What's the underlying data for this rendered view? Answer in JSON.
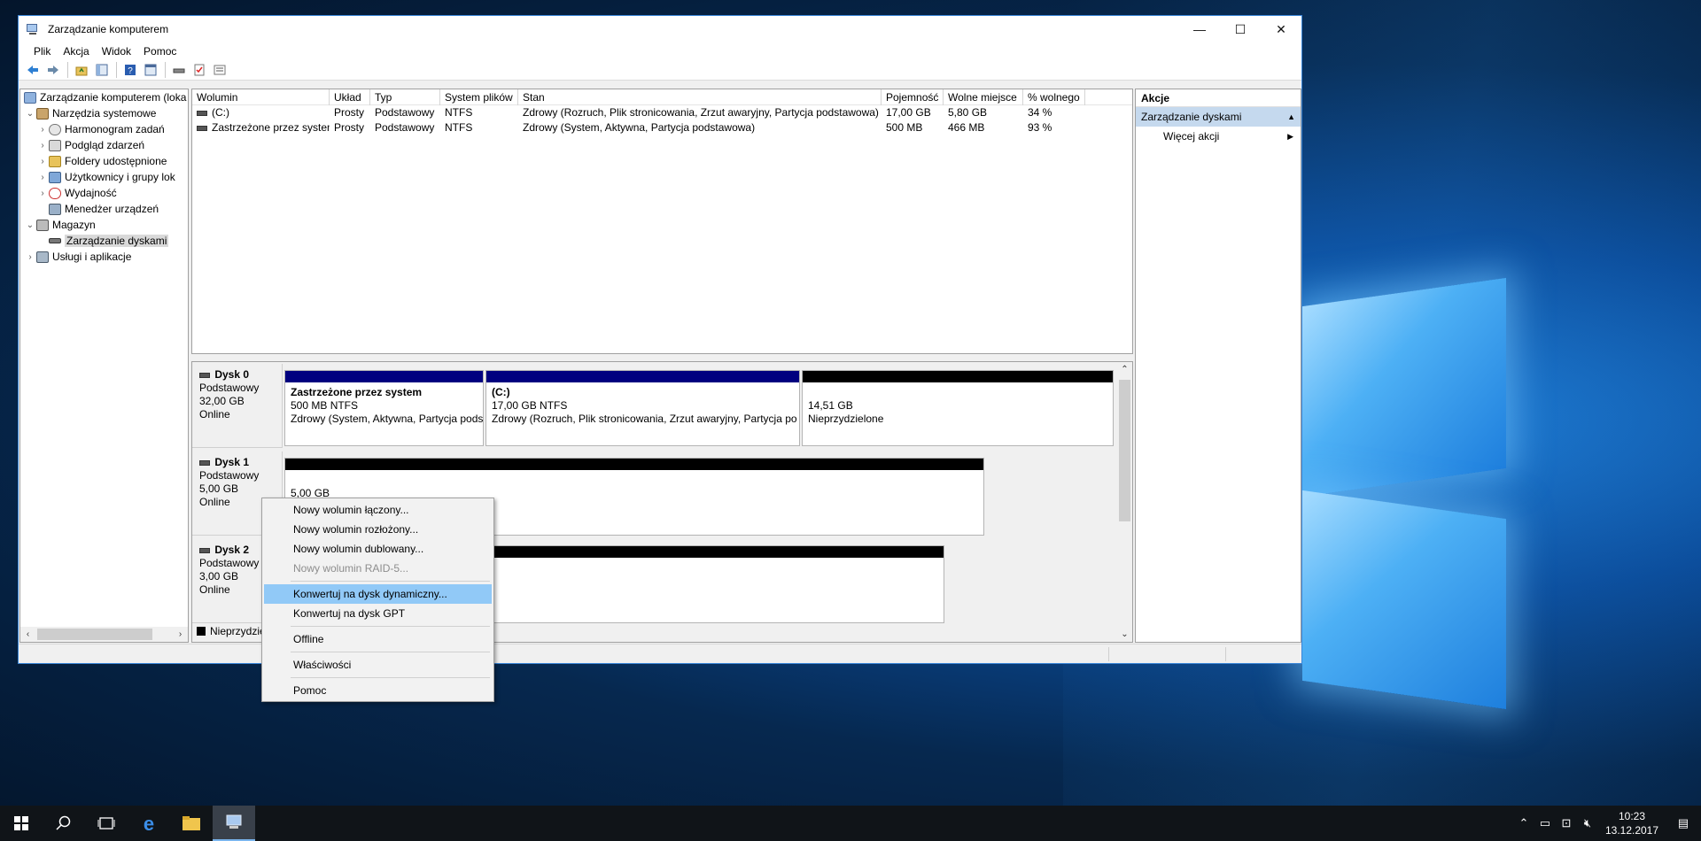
{
  "window": {
    "title": "Zarządzanie komputerem",
    "controls": {
      "minimize": "—",
      "maximize": "☐",
      "close": "✕"
    }
  },
  "menu": [
    "Plik",
    "Akcja",
    "Widok",
    "Pomoc"
  ],
  "toolbar_icons": [
    "back-icon",
    "forward-icon",
    "up-folder-icon",
    "show-tree-icon",
    "help-icon",
    "show-pane-icon",
    "disk-icon",
    "check-icon",
    "properties-icon"
  ],
  "tree": {
    "root": "Zarządzanie komputerem (loka",
    "system_tools": "Narzędzia systemowe",
    "task_scheduler": "Harmonogram zadań",
    "event_viewer": "Podgląd zdarzeń",
    "shared_folders": "Foldery udostępnione",
    "users_groups": "Użytkownicy i grupy lok",
    "performance": "Wydajność",
    "device_manager": "Menedżer urządzeń",
    "storage": "Magazyn",
    "disk_management": "Zarządzanie dyskami",
    "services_apps": "Usługi i aplikacje"
  },
  "volumes": {
    "headers": [
      "Wolumin",
      "Układ",
      "Typ",
      "System plików",
      "Stan",
      "Pojemność",
      "Wolne miejsce",
      "% wolnego"
    ],
    "rows": [
      [
        "(C:)",
        "Prosty",
        "Podstawowy",
        "NTFS",
        "Zdrowy (Rozruch, Plik stronicowania, Zrzut awaryjny, Partycja podstawowa)",
        "17,00 GB",
        "5,80 GB",
        "34 %"
      ],
      [
        "Zastrzeżone przez system",
        "Prosty",
        "Podstawowy",
        "NTFS",
        "Zdrowy (System, Aktywna, Partycja podstawowa)",
        "500 MB",
        "466 MB",
        "93 %"
      ]
    ]
  },
  "disks": {
    "disk0": {
      "name": "Dysk 0",
      "type": "Podstawowy",
      "size": "32,00 GB",
      "status": "Online",
      "p1": {
        "name": "Zastrzeżone przez system",
        "size": "500 MB NTFS",
        "state": "Zdrowy (System, Aktywna, Partycja pods"
      },
      "p2": {
        "name": "(C:)",
        "size": "17,00 GB NTFS",
        "state": "Zdrowy (Rozruch, Plik stronicowania, Zrzut awaryjny, Partycja po"
      },
      "p3": {
        "size": "14,51 GB",
        "state": "Nieprzydzielone"
      }
    },
    "disk1": {
      "name": "Dysk 1",
      "type": "Podstawowy",
      "size": "5,00 GB",
      "status": "Online",
      "p1_size": "5,00 GB"
    },
    "disk2": {
      "name": "Dysk 2",
      "type": "Podstawowy",
      "size": "3,00 GB",
      "status": "Online"
    },
    "legend_unallocated": "Nieprzydzie",
    "colors": {
      "primary": "#00007f",
      "unallocated": "#000000"
    }
  },
  "actions": {
    "header": "Akcje",
    "section": "Zarządzanie dyskami",
    "more": "Więcej akcji"
  },
  "context_menu": {
    "spanned": "Nowy wolumin łączony...",
    "striped": "Nowy wolumin rozłożony...",
    "mirrored": "Nowy wolumin dublowany...",
    "raid5": "Nowy wolumin RAID-5...",
    "convert_dynamic": "Konwertuj na dysk dynamiczny...",
    "convert_gpt": "Konwertuj na dysk GPT",
    "offline": "Offline",
    "properties": "Właściwości",
    "help": "Pomoc"
  },
  "taskbar": {
    "time": "10:23",
    "date": "13.12.2017"
  }
}
